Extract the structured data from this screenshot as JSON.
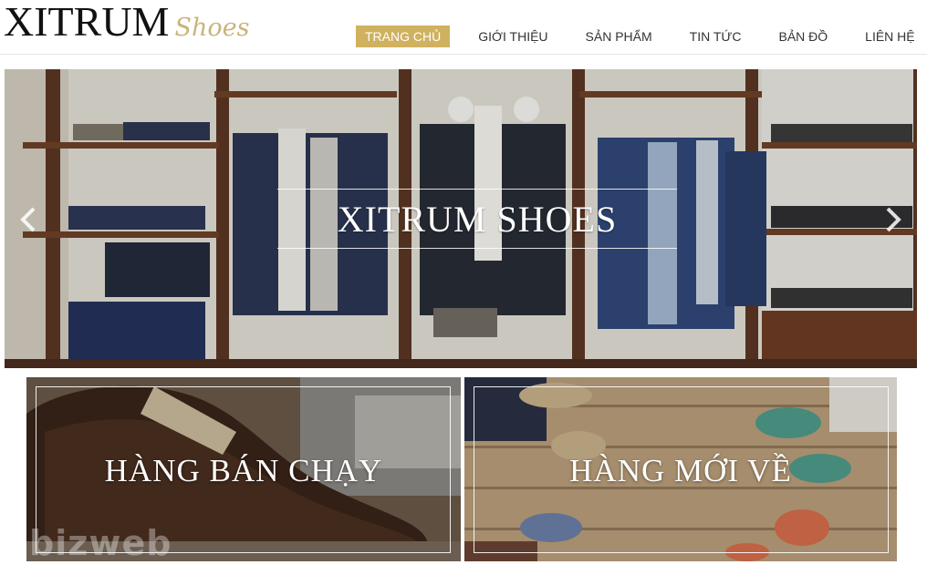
{
  "brand": {
    "name": "XITRUM",
    "tagline": "Shoes"
  },
  "nav": {
    "items": [
      {
        "label": "TRANG CHỦ",
        "active": true
      },
      {
        "label": "GIỚI THIỆU",
        "active": false
      },
      {
        "label": "SẢN PHẨM",
        "active": false
      },
      {
        "label": "TIN TỨC",
        "active": false
      },
      {
        "label": "BẢN ĐỒ",
        "active": false
      },
      {
        "label": "LIÊN HỆ",
        "active": false
      }
    ]
  },
  "hero": {
    "title": "XITRUM SHOES",
    "prev_icon": "chevron-left-icon",
    "next_icon": "chevron-right-icon"
  },
  "banners": [
    {
      "label": "HÀNG BÁN CHẠY"
    },
    {
      "label": "HÀNG MỚI VỀ"
    }
  ],
  "watermark": "bizweb",
  "colors": {
    "accent": "#cfb15f",
    "brand_gold": "#c9b47a",
    "text": "#333333"
  }
}
